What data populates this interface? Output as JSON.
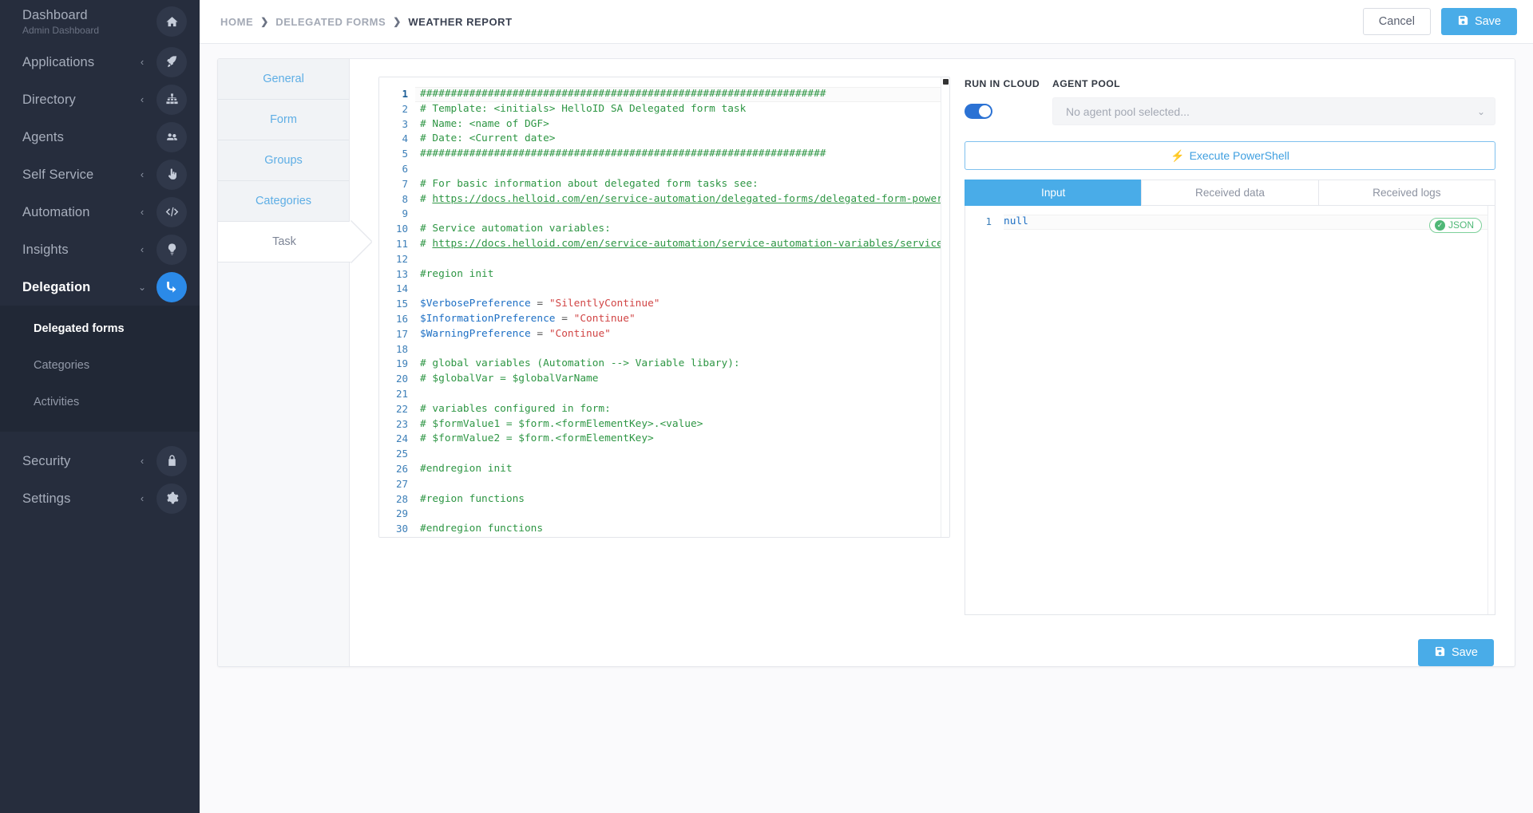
{
  "sidebar": {
    "items": [
      {
        "label": "Dashboard",
        "sub": "Admin Dashboard",
        "icon": "home-icon",
        "caret": "",
        "active": false
      },
      {
        "label": "Applications",
        "sub": "",
        "icon": "rocket-icon",
        "caret": "‹",
        "active": false
      },
      {
        "label": "Directory",
        "sub": "",
        "icon": "sitemap-icon",
        "caret": "‹",
        "active": false
      },
      {
        "label": "Agents",
        "sub": "",
        "icon": "agents-icon",
        "caret": "",
        "active": false
      },
      {
        "label": "Self Service",
        "sub": "",
        "icon": "hand-pointer-icon",
        "caret": "‹",
        "active": false
      },
      {
        "label": "Automation",
        "sub": "",
        "icon": "code-icon",
        "caret": "‹",
        "active": false
      },
      {
        "label": "Insights",
        "sub": "",
        "icon": "lightbulb-icon",
        "caret": "‹",
        "active": false
      },
      {
        "label": "Delegation",
        "sub": "",
        "icon": "delegation-arrow-icon",
        "caret": "⌄",
        "active": true
      }
    ],
    "submenu": [
      {
        "label": "Delegated forms",
        "active": true
      },
      {
        "label": "Categories",
        "active": false
      },
      {
        "label": "Activities",
        "active": false
      }
    ],
    "footer_items": [
      {
        "label": "Security",
        "icon": "lock-icon",
        "caret": "‹"
      },
      {
        "label": "Settings",
        "icon": "gear-icon",
        "caret": "‹"
      }
    ]
  },
  "topbar": {
    "breadcrumb": [
      "HOME",
      "DELEGATED FORMS"
    ],
    "breadcrumb_current": "WEATHER REPORT",
    "separator": "❯",
    "cancel_label": "Cancel",
    "save_label": "Save"
  },
  "tabs": [
    {
      "label": "General",
      "active": false
    },
    {
      "label": "Form",
      "active": false
    },
    {
      "label": "Groups",
      "active": false
    },
    {
      "label": "Categories",
      "active": false
    },
    {
      "label": "Task",
      "active": true
    }
  ],
  "editor": {
    "lines": [
      {
        "n": 1,
        "segments": [
          {
            "t": "comment",
            "v": "##################################################################"
          }
        ]
      },
      {
        "n": 2,
        "segments": [
          {
            "t": "comment",
            "v": "# Template: <initials> HelloID SA Delegated form task"
          }
        ]
      },
      {
        "n": 3,
        "segments": [
          {
            "t": "comment",
            "v": "# Name: <name of DGF>"
          }
        ]
      },
      {
        "n": 4,
        "segments": [
          {
            "t": "comment",
            "v": "# Date: <Current date>"
          }
        ]
      },
      {
        "n": 5,
        "segments": [
          {
            "t": "comment",
            "v": "##################################################################"
          }
        ]
      },
      {
        "n": 6,
        "segments": []
      },
      {
        "n": 7,
        "segments": [
          {
            "t": "comment",
            "v": "# For basic information about delegated form tasks see:"
          }
        ]
      },
      {
        "n": 8,
        "segments": [
          {
            "t": "comment",
            "v": "# "
          },
          {
            "t": "link",
            "v": "https://docs.helloid.com/en/service-automation/delegated-forms/delegated-form-power"
          }
        ]
      },
      {
        "n": 9,
        "segments": []
      },
      {
        "n": 10,
        "segments": [
          {
            "t": "comment",
            "v": "# Service automation variables:"
          }
        ]
      },
      {
        "n": 11,
        "segments": [
          {
            "t": "comment",
            "v": "# "
          },
          {
            "t": "link",
            "v": "https://docs.helloid.com/en/service-automation/service-automation-variables/service"
          }
        ]
      },
      {
        "n": 12,
        "segments": []
      },
      {
        "n": 13,
        "segments": [
          {
            "t": "kw",
            "v": "#region init"
          }
        ]
      },
      {
        "n": 14,
        "segments": []
      },
      {
        "n": 15,
        "segments": [
          {
            "t": "var",
            "v": "$VerbosePreference"
          },
          {
            "t": "op",
            "v": " = "
          },
          {
            "t": "str",
            "v": "\"SilentlyContinue\""
          }
        ]
      },
      {
        "n": 16,
        "segments": [
          {
            "t": "var",
            "v": "$InformationPreference"
          },
          {
            "t": "op",
            "v": " = "
          },
          {
            "t": "str",
            "v": "\"Continue\""
          }
        ]
      },
      {
        "n": 17,
        "segments": [
          {
            "t": "var",
            "v": "$WarningPreference"
          },
          {
            "t": "op",
            "v": " = "
          },
          {
            "t": "str",
            "v": "\"Continue\""
          }
        ]
      },
      {
        "n": 18,
        "segments": []
      },
      {
        "n": 19,
        "segments": [
          {
            "t": "comment",
            "v": "# global variables (Automation --> Variable libary):"
          }
        ]
      },
      {
        "n": 20,
        "segments": [
          {
            "t": "comment",
            "v": "# $globalVar = $globalVarName"
          }
        ]
      },
      {
        "n": 21,
        "segments": []
      },
      {
        "n": 22,
        "segments": [
          {
            "t": "comment",
            "v": "# variables configured in form:"
          }
        ]
      },
      {
        "n": 23,
        "segments": [
          {
            "t": "comment",
            "v": "# $formValue1 = $form.<formElementKey>.<value>"
          }
        ]
      },
      {
        "n": 24,
        "segments": [
          {
            "t": "comment",
            "v": "# $formValue2 = $form.<formElementKey>"
          }
        ]
      },
      {
        "n": 25,
        "segments": []
      },
      {
        "n": 26,
        "segments": [
          {
            "t": "kw",
            "v": "#endregion init"
          }
        ]
      },
      {
        "n": 27,
        "segments": []
      },
      {
        "n": 28,
        "segments": [
          {
            "t": "kw",
            "v": "#region functions"
          }
        ]
      },
      {
        "n": 29,
        "segments": []
      },
      {
        "n": 30,
        "segments": [
          {
            "t": "kw",
            "v": "#endregion functions"
          }
        ]
      }
    ]
  },
  "right_panel": {
    "run_in_cloud_label": "RUN IN CLOUD",
    "agent_pool_label": "AGENT POOL",
    "run_in_cloud_on": true,
    "agent_pool_value": "No agent pool selected...",
    "agent_pool_chevron": "⌄",
    "execute_label": "Execute PowerShell",
    "execute_icon": "⚡",
    "result_tabs": [
      {
        "label": "Input",
        "active": true
      },
      {
        "label": "Received data",
        "active": false
      },
      {
        "label": "Received logs",
        "active": false
      }
    ],
    "json_line_number": "1",
    "json_value": "null",
    "json_badge_label": "JSON",
    "json_badge_check": "✓",
    "save_label": "Save"
  },
  "colors": {
    "accent_blue": "#49ace8",
    "toggle_blue": "#2b72d4",
    "sidebar_bg": "#262d3d",
    "submenu_bg": "#21283e",
    "comment_green": "#2e9644",
    "string_red": "#d14545",
    "variable_blue": "#1d6fc4",
    "json_badge_green": "#4fb877"
  }
}
